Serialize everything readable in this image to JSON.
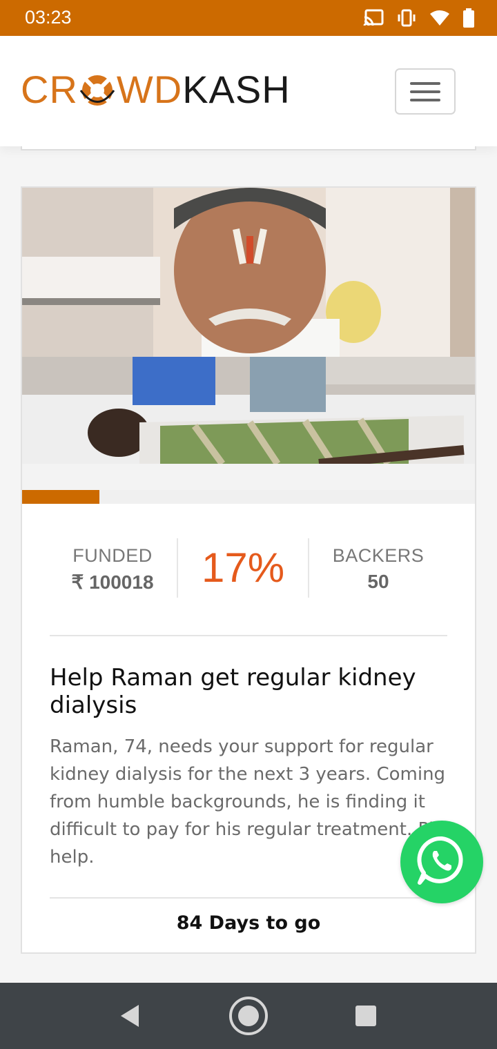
{
  "status_bar": {
    "time": "03:23",
    "icons": [
      "cast-icon",
      "vibrate-icon",
      "wifi-icon",
      "battery-icon"
    ]
  },
  "header": {
    "logo_text_orange": "CR",
    "logo_text_orange_2": "WD",
    "logo_text_dark": "KASH",
    "menu_icon": "hamburger-icon"
  },
  "campaign": {
    "progress_percent": 17,
    "funded_label": "FUNDED",
    "funded_value": "₹ 100018",
    "percent_text": "17%",
    "backers_label": "BACKERS",
    "backers_value": "50",
    "title": "Help Raman get regular kidney dialysis",
    "description": "Raman, 74, needs your support for regular kidney dialysis for the next 3 years. Coming from humble backgrounds, he is finding it difficult to pay for his regular treatment. Pls help.",
    "days_left": "84 Days to go"
  },
  "floating": {
    "whatsapp_icon": "whatsapp-icon"
  },
  "nav_bar": {
    "buttons": [
      "back-icon",
      "home-icon",
      "recents-icon"
    ]
  },
  "colors": {
    "brand": "#cc6a00",
    "percent": "#e55a1c",
    "whatsapp": "#25d366"
  }
}
